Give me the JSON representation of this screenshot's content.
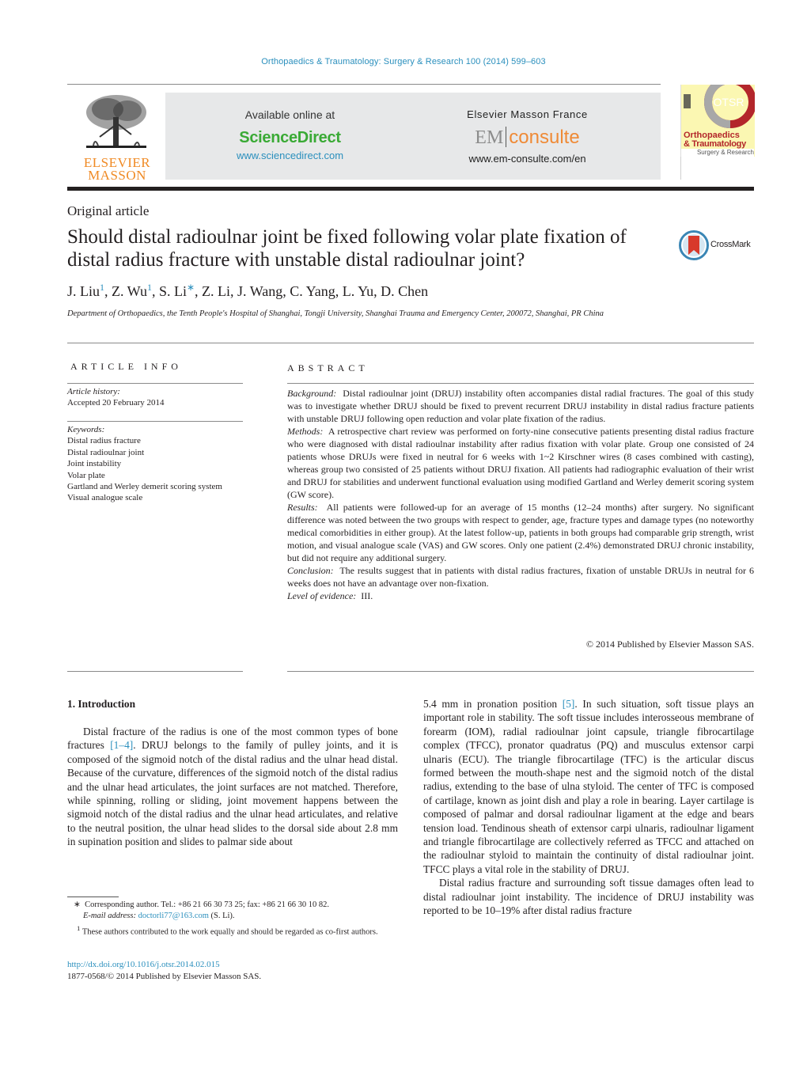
{
  "header": {
    "journal_reference": "Orthopaedics & Traumatology: Surgery & Research 100 (2014) 599–603",
    "publisher_logo": {
      "line1": "ELSEVIER",
      "line2": "MASSON"
    },
    "banner": {
      "available_online": "Available online at",
      "sciencedirect_brand": "ScienceDirect",
      "sciencedirect_url": "www.sciencedirect.com",
      "em_publisher": "Elsevier Masson France",
      "em_logo_left": "EM",
      "em_logo_right": "consulte",
      "em_url": "www.em-consulte.com/en"
    },
    "cover": {
      "badge": "OTSR",
      "line1": "Orthopaedics",
      "line2": "& Traumatology",
      "line3": "Surgery & Research"
    }
  },
  "article": {
    "type": "Original article",
    "title": "Should distal radioulnar joint be fixed following volar plate fixation of distal radius fracture with unstable distal radioulnar joint?",
    "crossmark_label": "CrossMark",
    "authors": [
      {
        "name": "J. Liu",
        "mark": "1"
      },
      {
        "name": "Z. Wu",
        "mark": "1"
      },
      {
        "name": "S. Li",
        "mark": "∗"
      },
      {
        "name": "Z. Li",
        "mark": ""
      },
      {
        "name": "J. Wang",
        "mark": ""
      },
      {
        "name": "C. Yang",
        "mark": ""
      },
      {
        "name": "L. Yu",
        "mark": ""
      },
      {
        "name": "D. Chen",
        "mark": ""
      }
    ],
    "affiliation": "Department of Orthopaedics, the Tenth People's Hospital of Shanghai, Tongji University, Shanghai Trauma and Emergency Center, 200072, Shanghai, PR China"
  },
  "article_info": {
    "heading": "ARTICLE INFO",
    "history_label": "Article history:",
    "history_value": "Accepted 20 February 2014",
    "keywords_label": "Keywords:",
    "keywords": [
      "Distal radius fracture",
      "Distal radioulnar joint",
      "Joint instability",
      "Volar plate",
      "Gartland and Werley demerit scoring system",
      "Visual analogue scale"
    ]
  },
  "abstract": {
    "heading": "ABSTRACT",
    "sections": [
      {
        "label": "Background:",
        "text": "Distal radioulnar joint (DRUJ) instability often accompanies distal radial fractures. The goal of this study was to investigate whether DRUJ should be fixed to prevent recurrent DRUJ instability in distal radius fracture patients with unstable DRUJ following open reduction and volar plate fixation of the radius."
      },
      {
        "label": "Methods:",
        "text": "A retrospective chart review was performed on forty-nine consecutive patients presenting distal radius fracture who were diagnosed with distal radioulnar instability after radius fixation with volar plate. Group one consisted of 24 patients whose DRUJs were fixed in neutral for 6 weeks with 1~2 Kirschner wires (8 cases combined with casting), whereas group two consisted of 25 patients without DRUJ fixation. All patients had radiographic evaluation of their wrist and DRUJ for stabilities and underwent functional evaluation using modified Gartland and Werley demerit scoring system (GW score)."
      },
      {
        "label": "Results:",
        "text": "All patients were followed-up for an average of 15 months (12–24 months) after surgery. No significant difference was noted between the two groups with respect to gender, age, fracture types and damage types (no noteworthy medical comorbidities in either group). At the latest follow-up, patients in both groups had comparable grip strength, wrist motion, and visual analogue scale (VAS) and GW scores. Only one patient (2.4%) demonstrated DRUJ chronic instability, but did not require any additional surgery."
      },
      {
        "label": "Conclusion:",
        "text": "The results suggest that in patients with distal radius fractures, fixation of unstable DRUJs in neutral for 6 weeks does not have an advantage over non-fixation."
      },
      {
        "label": "Level of evidence:",
        "text": "III."
      }
    ],
    "copyright": "© 2014 Published by Elsevier Masson SAS."
  },
  "body": {
    "section_heading": "1.  Introduction",
    "left_column": {
      "p1_before_ref": "Distal fracture of the radius is one of the most common types of bone fractures ",
      "p1_ref": "[1–4]",
      "p1_after_ref": ". DRUJ belongs to the family of pulley joints, and it is composed of the sigmoid notch of the distal radius and the ulnar head distal. Because of the curvature, differences of the sigmoid notch of the distal radius and the ulnar head articulates, the joint surfaces are not matched. Therefore, while spinning, rolling or sliding, joint movement happens between the sigmoid notch of the distal radius and the ulnar head articulates, and relative to the neutral position, the ulnar head slides to the dorsal side about 2.8 mm in supination position and slides to palmar side about"
    },
    "right_column": {
      "p1_before_ref": "5.4 mm in pronation position ",
      "p1_ref": "[5]",
      "p1_after_ref": ". In such situation, soft tissue plays an important role in stability. The soft tissue includes interosseous membrane of forearm (IOM), radial radioulnar joint capsule, triangle fibrocartilage complex (TFCC), pronator quadratus (PQ) and musculus extensor carpi ulnaris (ECU). The triangle fibrocartilage (TFC) is the articular discus formed between the mouth-shape nest and the sigmoid notch of the distal radius, extending to the base of ulna styloid. The center of TFC is composed of cartilage, known as joint dish and play a role in bearing. Layer cartilage is composed of palmar and dorsal radioulnar ligament at the edge and bears tension load. Tendinous sheath of extensor carpi ulnaris, radioulnar ligament and triangle fibrocartilage are collectively referred as TFCC and attached on the radioulnar styloid to maintain the continuity of distal radioulnar joint. TFCC plays a vital role in the stability of DRUJ.",
      "p2": "Distal radius fracture and surrounding soft tissue damages often lead to distal radioulnar joint instability. The incidence of DRUJ instability was reported to be 10–19% after distal radius fracture"
    }
  },
  "footnotes": {
    "corresponding_mark": "∗",
    "corresponding_text": "Corresponding author. Tel.: +86 21 66 30 73 25; fax: +86 21 66 30 10 82.",
    "email_label": "E-mail address:",
    "email": "doctorli77@163.com",
    "email_suffix": " (S. Li).",
    "cofirst_mark": "1",
    "cofirst_text": "These authors contributed to the work equally and should be regarded as co-first authors.",
    "doi": "http://dx.doi.org/10.1016/j.otsr.2014.02.015",
    "issn_copyright": "1877-0568/© 2014 Published by Elsevier Masson SAS."
  },
  "colors": {
    "link": "#2a8fbd",
    "sciencedirect_green": "#3aaa35",
    "elsevier_orange": "#f08a24",
    "em_orange": "#ef8a36",
    "banner_gray": "#e7e8e9",
    "cover_yellow": "#fbf7b2",
    "otsr_red": "#b3262b"
  }
}
